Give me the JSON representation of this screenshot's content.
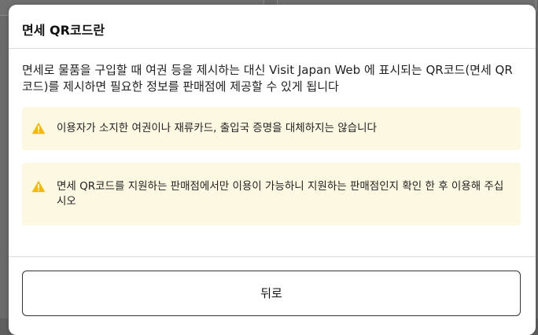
{
  "modal": {
    "title": "면세 QR코드란",
    "description": "면세로 물품을 구입할 때 여권 등을 제시하는 대신 Visit Japan Web 에 표시되는 QR코드(면세 QR코드)를 제시하면 필요한 정보를 판매점에 제공할 수 있게 됩니다",
    "notices": [
      {
        "icon": "warning-icon",
        "text": "이용자가 소지한 여권이나 재류카드, 출입국 증명을 대체하지는 않습니다"
      },
      {
        "icon": "warning-icon",
        "text": "면세 QR코드를 지원하는 판매점에서만 이용이 가능하니 지원하는 판매점인지 확인 한 후 이용해 주십시오"
      }
    ],
    "back_label": "뒤로"
  },
  "colors": {
    "notice_background": "#fdf8e2",
    "warning": "#f5b800",
    "overlay": "#6a6a6a"
  }
}
